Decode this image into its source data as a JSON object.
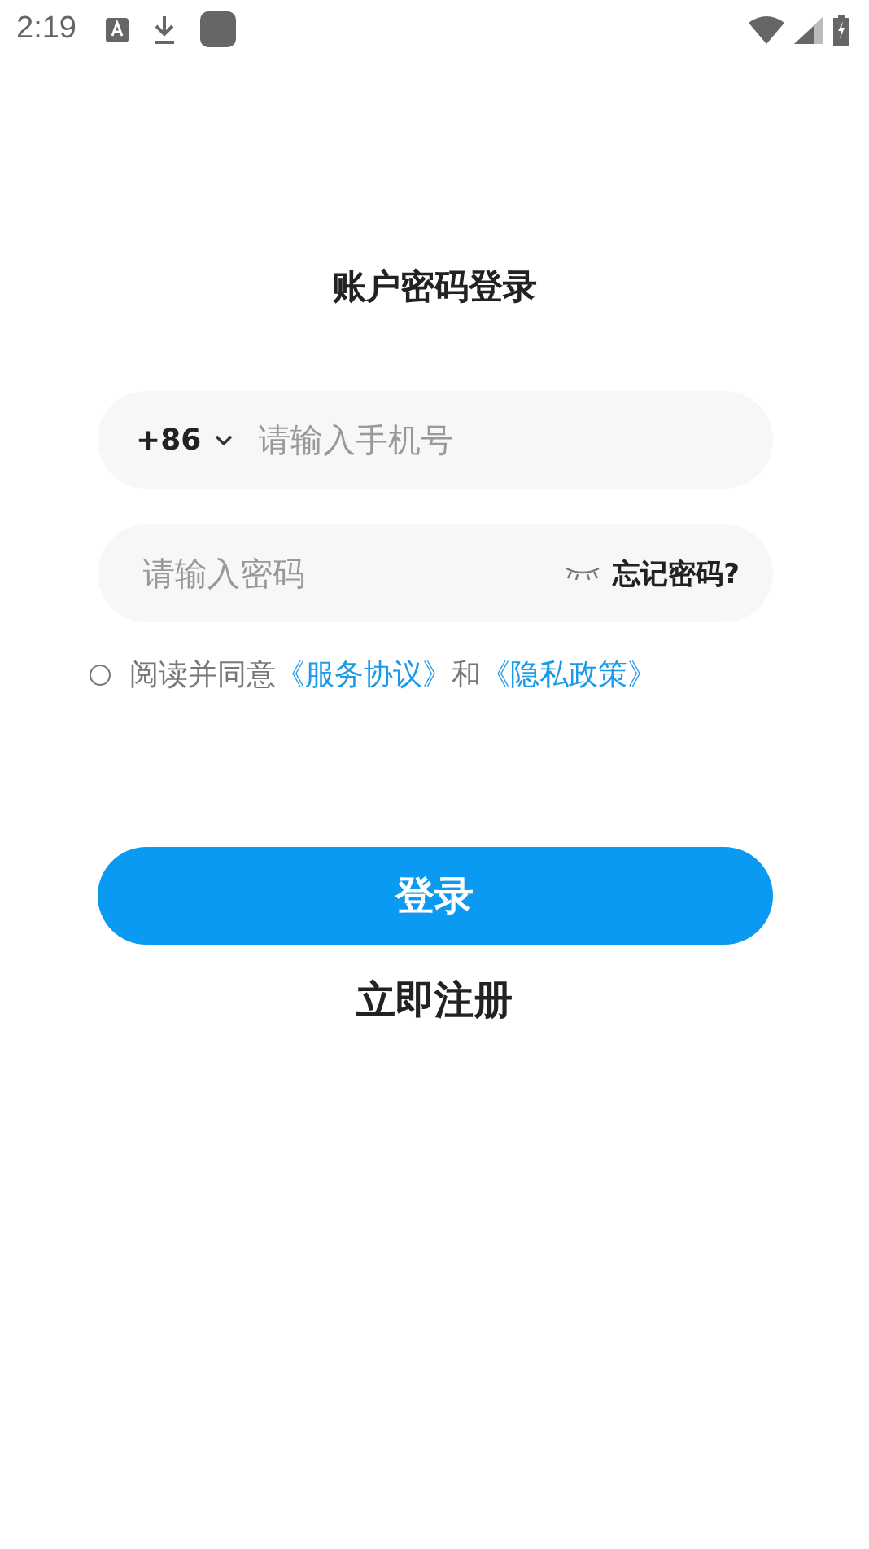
{
  "status_bar": {
    "time": "2:19"
  },
  "title": "账户密码登录",
  "phone_field": {
    "country_code": "+86",
    "placeholder": "请输入手机号"
  },
  "password_field": {
    "placeholder": "请输入密码",
    "forgot_link": "忘记密码?"
  },
  "agreement": {
    "checked": false,
    "prefix": "阅读并同意",
    "links": [
      {
        "text": "《服务协议》"
      },
      {
        "text": "《隐私政策》"
      }
    ],
    "conjunction": "和"
  },
  "login_button": "登录",
  "register_link": "立即注册"
}
